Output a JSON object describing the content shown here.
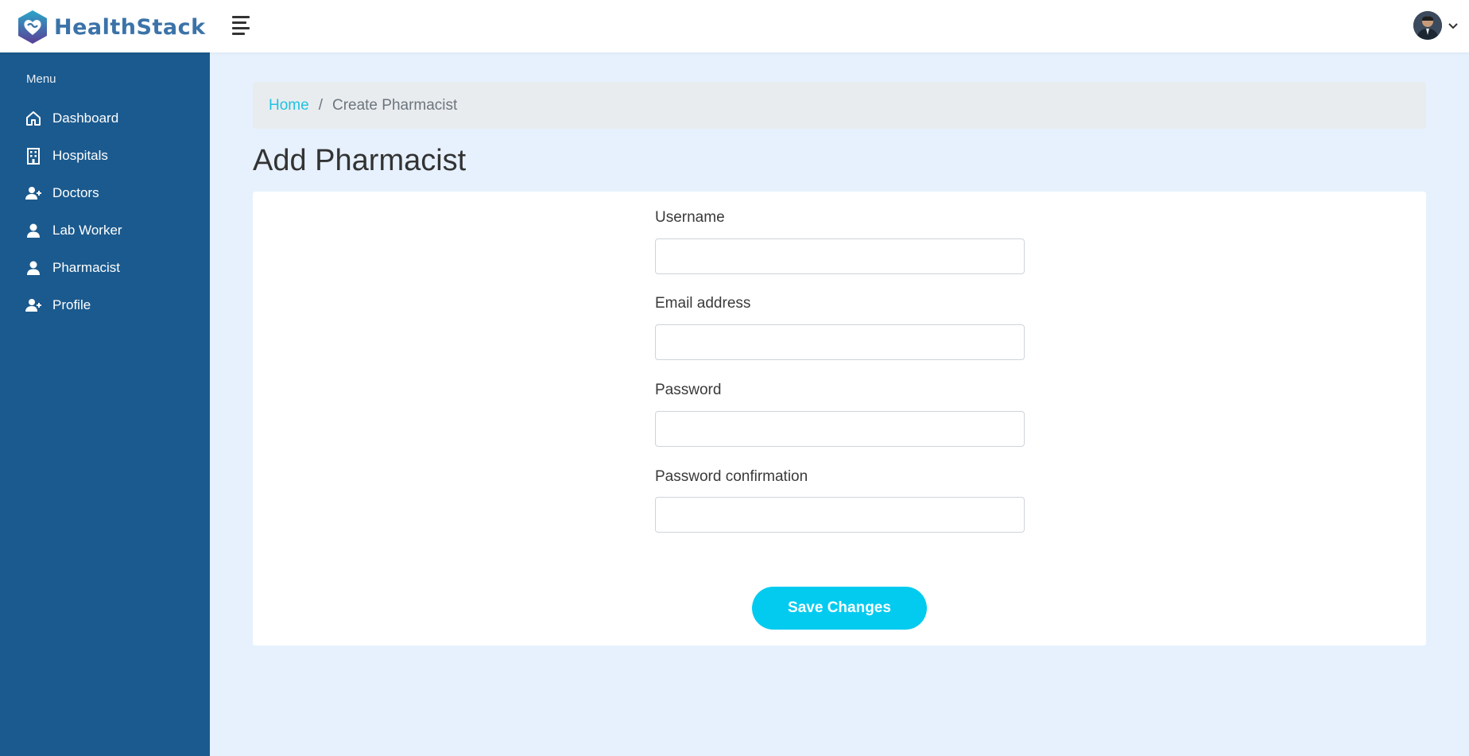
{
  "brand": {
    "name": "HealthStack",
    "logo_icon": "heart-shield-logo"
  },
  "header": {
    "menu_toggle_icon": "hamburger-icon",
    "avatar_icon": "user-avatar",
    "dropdown_icon": "chevron-down-icon"
  },
  "sidebar": {
    "title": "Menu",
    "items": [
      {
        "label": "Dashboard",
        "icon": "home-icon"
      },
      {
        "label": "Hospitals",
        "icon": "building-icon"
      },
      {
        "label": "Doctors",
        "icon": "user-plus-icon"
      },
      {
        "label": "Lab Worker",
        "icon": "user-icon"
      },
      {
        "label": "Pharmacist",
        "icon": "user-icon"
      },
      {
        "label": "Profile",
        "icon": "user-plus-icon"
      }
    ]
  },
  "breadcrumb": {
    "home": "Home",
    "separator": "/",
    "current": "Create Pharmacist"
  },
  "page": {
    "title": "Add Pharmacist"
  },
  "form": {
    "fields": [
      {
        "label": "Username",
        "value": "",
        "placeholder": ""
      },
      {
        "label": "Email address",
        "value": "",
        "placeholder": ""
      },
      {
        "label": "Password",
        "value": "",
        "placeholder": ""
      },
      {
        "label": "Password confirmation",
        "value": "",
        "placeholder": ""
      }
    ],
    "submit_label": "Save Changes"
  },
  "colors": {
    "sidebar_bg": "#1b5a8e",
    "accent": "#03cbf0",
    "link": "#1ec3e3",
    "page_bg": "#e6f1fd"
  }
}
